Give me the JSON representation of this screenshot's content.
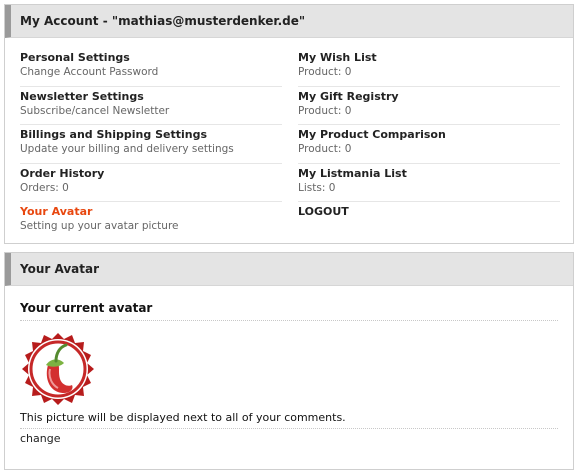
{
  "account": {
    "title": "My Account - \"mathias@musterdenker.de\"",
    "left_items": [
      {
        "title": "Personal Settings",
        "sub": "Change Account Password"
      },
      {
        "title": "Newsletter Settings",
        "sub": "Subscribe/cancel Newsletter"
      },
      {
        "title": "Billings and Shipping Settings",
        "sub": "Update your billing and delivery settings"
      },
      {
        "title": "Order History",
        "sub": "Orders: 0"
      },
      {
        "title": "Your Avatar",
        "sub": "Setting up your avatar picture"
      }
    ],
    "right_items": [
      {
        "title": "My Wish List",
        "sub": "Product: 0"
      },
      {
        "title": "My Gift Registry",
        "sub": "Product: 0"
      },
      {
        "title": "My Product Comparison",
        "sub": "Product: 0"
      },
      {
        "title": "My Listmania List",
        "sub": "Lists: 0"
      },
      {
        "title": "LOGOUT",
        "sub": ""
      }
    ],
    "active_color": "#e8470f"
  },
  "avatar": {
    "title": "Your Avatar",
    "heading": "Your current avatar",
    "image": "chili-pepper-avatar",
    "description": "This picture will be displayed next to all of your comments.",
    "change_label": "change"
  }
}
